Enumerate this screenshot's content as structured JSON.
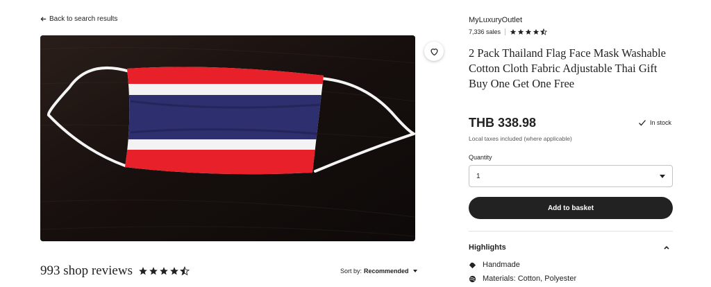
{
  "nav": {
    "back_label": "Back to search results"
  },
  "product": {
    "image_alt": "Thailand flag face mask on dark wooden surface",
    "favorite_icon": "heart-icon"
  },
  "reviews": {
    "count_label": "993 shop reviews",
    "rating": 4.5,
    "sort_prefix": "Sort by:",
    "sort_value": "Recommended"
  },
  "shop": {
    "name": "MyLuxuryOutlet",
    "sales": "7,336 sales",
    "rating": 4.5
  },
  "listing": {
    "title": "2 Pack Thailand Flag Face Mask Washable Cotton Cloth Fabric Adjustable Thai Gift Buy One Get One Free",
    "price": "THB 338.98",
    "stock": "In stock",
    "tax_note": "Local taxes included (where applicable)",
    "quantity_label": "Quantity",
    "quantity_value": "1",
    "add_to_basket": "Add to basket"
  },
  "highlights": {
    "title": "Highlights",
    "items": [
      {
        "icon": "hand-icon",
        "text": "Handmade"
      },
      {
        "icon": "yarn-icon",
        "text": "Materials: Cotton, Polyester"
      }
    ]
  },
  "colors": {
    "button_bg": "#222222",
    "text": "#222222",
    "flag_red": "#e8202a",
    "flag_blue": "#2d2f6e"
  }
}
